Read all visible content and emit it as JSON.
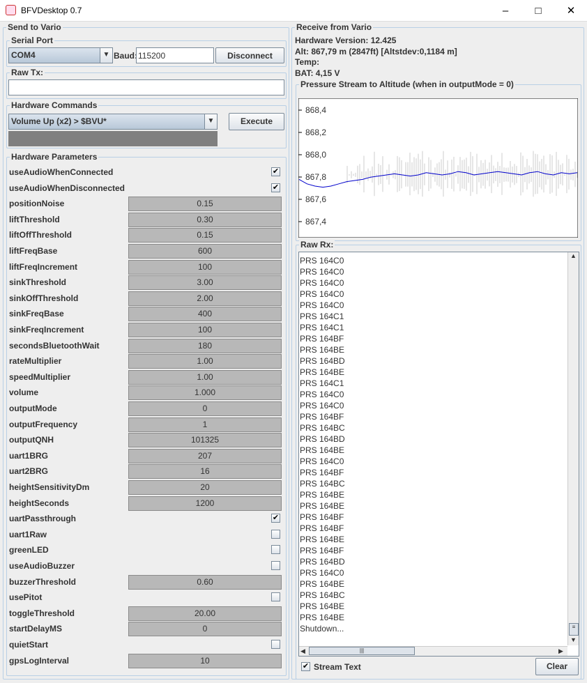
{
  "window": {
    "title": "BFVDesktop 0.7"
  },
  "send": {
    "title": "Send to Vario",
    "serial": {
      "title": "Serial Port",
      "port": "COM4",
      "baud_label": "Baud:",
      "baud": "115200",
      "connect_label": "Disconnect"
    },
    "rawtx": {
      "title": "Raw Tx:",
      "value": ""
    },
    "commands": {
      "title": "Hardware Commands",
      "selected": "Volume Up (x2) > $BVU*",
      "execute_label": "Execute"
    },
    "params": {
      "title": "Hardware Parameters",
      "items": [
        {
          "name": "useAudioWhenConnected",
          "type": "check",
          "checked": true
        },
        {
          "name": "useAudioWhenDisconnected",
          "type": "check",
          "checked": true
        },
        {
          "name": "positionNoise",
          "value": "0.15"
        },
        {
          "name": "liftThreshold",
          "value": "0.30"
        },
        {
          "name": "liftOffThreshold",
          "value": "0.15"
        },
        {
          "name": "liftFreqBase",
          "value": "600"
        },
        {
          "name": "liftFreqIncrement",
          "value": "100"
        },
        {
          "name": "sinkThreshold",
          "value": "3.00"
        },
        {
          "name": "sinkOffThreshold",
          "value": "2.00"
        },
        {
          "name": "sinkFreqBase",
          "value": "400"
        },
        {
          "name": "sinkFreqIncrement",
          "value": "100"
        },
        {
          "name": "secondsBluetoothWait",
          "value": "180"
        },
        {
          "name": "rateMultiplier",
          "value": "1.00"
        },
        {
          "name": "speedMultiplier",
          "value": "1.00"
        },
        {
          "name": "volume",
          "value": "1.000"
        },
        {
          "name": "outputMode",
          "value": "0"
        },
        {
          "name": "outputFrequency",
          "value": "1"
        },
        {
          "name": "outputQNH",
          "value": "101325"
        },
        {
          "name": "uart1BRG",
          "value": "207"
        },
        {
          "name": "uart2BRG",
          "value": "16"
        },
        {
          "name": "heightSensitivityDm",
          "value": "20"
        },
        {
          "name": "heightSeconds",
          "value": "1200"
        },
        {
          "name": "uartPassthrough",
          "type": "check",
          "checked": true
        },
        {
          "name": "uart1Raw",
          "type": "check",
          "checked": false
        },
        {
          "name": "greenLED",
          "type": "check",
          "checked": false
        },
        {
          "name": "useAudioBuzzer",
          "type": "check",
          "checked": false
        },
        {
          "name": "buzzerThreshold",
          "value": "0.60"
        },
        {
          "name": "usePitot",
          "type": "check",
          "checked": false
        },
        {
          "name": "toggleThreshold",
          "value": "20.00"
        },
        {
          "name": "startDelayMS",
          "value": "0"
        },
        {
          "name": "quietStart",
          "type": "check",
          "checked": false
        },
        {
          "name": "gpsLogInterval",
          "value": "10"
        }
      ]
    }
  },
  "receive": {
    "title": "Receive from Vario",
    "hw_version": "Hardware Version: 12.425",
    "alt": "Alt: 867,79 m (2847ft) [Altstdev:0,1184 m]",
    "temp": "Temp:",
    "bat": "BAT: 4,15 V",
    "chart_title": "Pressure Stream to Altitude (when in outputMode = 0)",
    "rx_title": "Raw Rx:",
    "rx_lines": [
      "PRS 164C0",
      "PRS 164C0",
      "PRS 164C0",
      "PRS 164C0",
      "PRS 164C0",
      "PRS 164C1",
      "PRS 164C1",
      "PRS 164BF",
      "PRS 164BE",
      "PRS 164BD",
      "PRS 164BE",
      "PRS 164C1",
      "PRS 164C0",
      "PRS 164C0",
      "PRS 164BF",
      "PRS 164BC",
      "PRS 164BD",
      "PRS 164BE",
      "PRS 164C0",
      "PRS 164BF",
      "PRS 164BC",
      "PRS 164BE",
      "PRS 164BE",
      "PRS 164BF",
      "PRS 164BF",
      "PRS 164BE",
      "PRS 164BF",
      "PRS 164BD",
      "PRS 164C0",
      "PRS 164BE",
      "PRS 164BC",
      "PRS 164BE",
      "PRS 164BE",
      "Shutdown..."
    ],
    "stream_text_label": "Stream Text",
    "stream_text_checked": true,
    "clear_label": "Clear"
  },
  "chart_data": {
    "type": "line",
    "yticks": [
      "868,4",
      "868,2",
      "868,0",
      "867,8",
      "867,6",
      "867,4",
      "867,2"
    ],
    "ylim": [
      867.2,
      868.45
    ],
    "line_color": "#0000cc",
    "noise_color": "#cccccc",
    "series": [
      {
        "values": [
          867.76,
          867.72,
          867.7,
          867.69,
          867.7,
          867.72,
          867.74,
          867.75,
          867.76,
          867.78,
          867.79,
          867.8,
          867.81,
          867.8,
          867.79,
          867.8,
          867.82,
          867.81,
          867.8,
          867.81,
          867.83,
          867.82,
          867.8,
          867.81,
          867.82,
          867.83,
          867.82,
          867.81,
          867.8,
          867.82,
          867.83,
          867.81,
          867.8,
          867.82,
          867.81,
          867.82
        ]
      }
    ]
  }
}
